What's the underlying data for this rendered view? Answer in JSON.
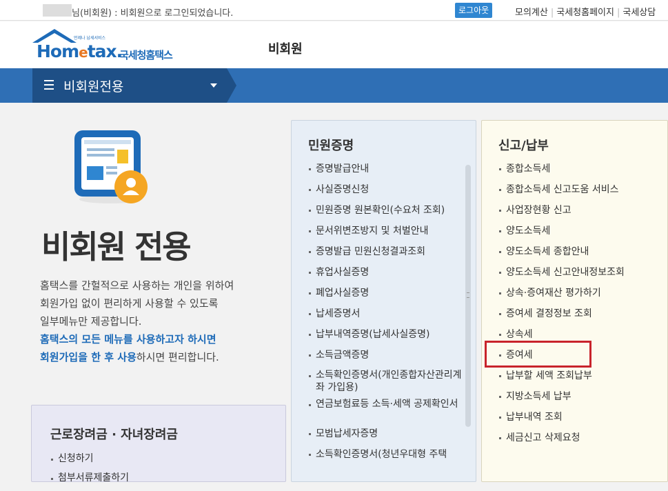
{
  "topbar": {
    "login_message": "님(비회원) : 비회원으로 로그인되었습니다.",
    "logout_label": "로그아웃",
    "links": [
      "모의계산",
      "국세청홈페이지",
      "국세상담"
    ]
  },
  "header": {
    "logo_brand": "Hometax",
    "logo_tagline": "언제나 납세서비스",
    "logo_korean": "국세청홈택스",
    "page_title": "비회원"
  },
  "nav": {
    "menu_label": "비회원전용"
  },
  "intro": {
    "title": "비회원 전용",
    "desc_line1": "홈택스를 간헐적으로 사용하는 개인을 위하여",
    "desc_line2": "회원가입 없이 편리하게 사용할 수 있도록",
    "desc_line3": "일부메뉴만 제공합니다.",
    "desc_blue1": "홈택스의 모든 메뉴를 사용하고자 하시면",
    "desc_blue2": "회원가입을 한 후 사용",
    "desc_tail2": "하시면 편리합니다."
  },
  "civil": {
    "title": "민원증명",
    "items": [
      "증명발급안내",
      "사실증명신청",
      "민원증명 원본확인(수요처 조회)",
      "문서위변조방지 및 처벌안내",
      "증명발급 민원신청결과조회",
      "휴업사실증명",
      "폐업사실증명",
      "납세증명서",
      "납부내역증명(납세사실증명)",
      "소득금액증명",
      "소득확인증명서(개인종합자산관리계좌 가입용)",
      "연금보험료등 소득·세액 공제확인서",
      "모범납세자증명",
      "소득확인증명서(청년우대형 주택"
    ]
  },
  "tax": {
    "title": "신고/납부",
    "items": [
      "종합소득세",
      "종합소득세 신고도움 서비스",
      "사업장현황 신고",
      "양도소득세",
      "양도소득세 종합안내",
      "양도소득세 신고안내정보조회",
      "상속·증여재산 평가하기",
      "증여세 결정정보 조회",
      "상속세",
      "증여세",
      "납부할 세액 조회납부",
      "지방소득세 납부",
      "납부내역 조회",
      "세금신고 삭제요청"
    ]
  },
  "labor": {
    "title": "근로장려금 · 자녀장려금",
    "items": [
      "신청하기",
      "첨부서류제출하기"
    ]
  },
  "colors": {
    "nav_blue": "#2f6fb5",
    "nav_dark": "#1e4f86",
    "highlight_red": "#c8232b"
  }
}
